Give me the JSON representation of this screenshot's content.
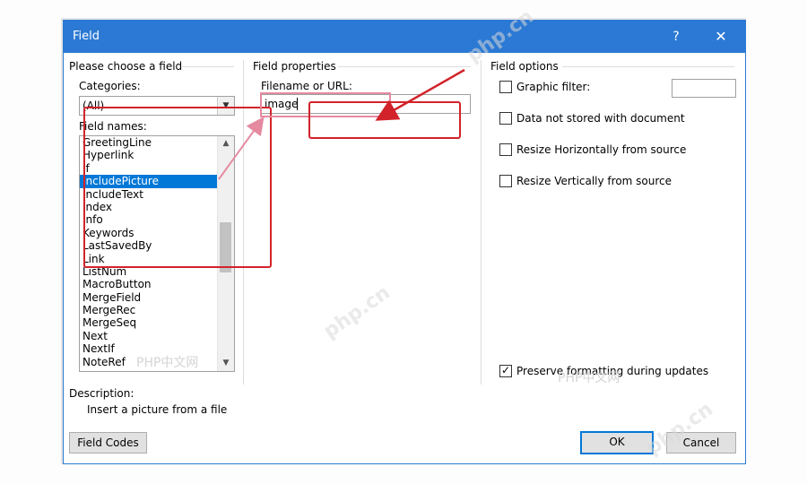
{
  "window": {
    "title": "Field",
    "help_glyph": "?",
    "close_glyph": "✕"
  },
  "left_panel": {
    "heading": "Please choose a field",
    "categories_label": "Categories:",
    "category_value": "(All)",
    "field_names_label": "Field names:",
    "field_names": [
      "GreetingLine",
      "Hyperlink",
      "If",
      "IncludePicture",
      "IncludeText",
      "Index",
      "Info",
      "Keywords",
      "LastSavedBy",
      "Link",
      "ListNum",
      "MacroButton",
      "MergeField",
      "MergeRec",
      "MergeSeq",
      "Next",
      "NextIf",
      "NoteRef"
    ],
    "selected_field_index": 3
  },
  "middle_panel": {
    "heading": "Field properties",
    "filename_label": "Filename or URL:",
    "filename_value": "image"
  },
  "right_panel": {
    "heading": "Field options",
    "options": [
      {
        "label": "Graphic filter:",
        "checked": false
      },
      {
        "label": "Data not stored with document",
        "checked": false
      },
      {
        "label": "Resize Horizontally from source",
        "checked": false
      },
      {
        "label": "Resize Vertically from source",
        "checked": false
      }
    ],
    "preserve_label": "Preserve formatting during updates",
    "preserve_checked": true
  },
  "description": {
    "label": "Description:",
    "text": "Insert a picture from a file"
  },
  "buttons": {
    "field_codes": "Field Codes",
    "ok": "OK",
    "cancel": "Cancel"
  },
  "watermarks": {
    "site": "php.cn",
    "brand": "PHP中文网"
  },
  "colors": {
    "titlebar": "#2b79d4",
    "selection": "#0078d7",
    "annotation_red": "#d2232a",
    "annotation_pink": "#e58aa0"
  }
}
